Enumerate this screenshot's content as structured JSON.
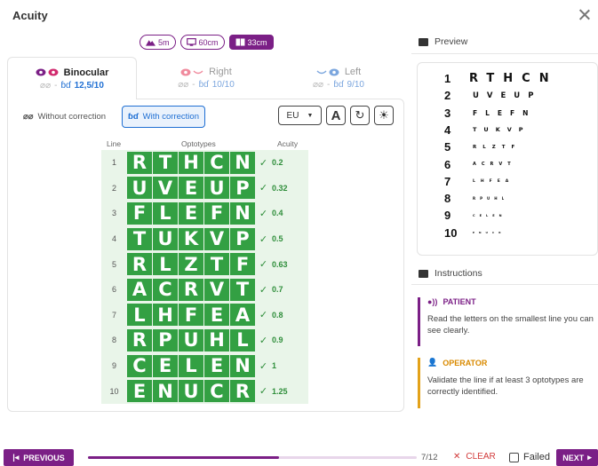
{
  "page": {
    "title": "Acuity"
  },
  "distances": [
    {
      "label": "5m",
      "icon": "mountain-icon",
      "active": false
    },
    {
      "label": "60cm",
      "icon": "monitor-icon",
      "active": false
    },
    {
      "label": "33cm",
      "icon": "book-icon",
      "active": true
    }
  ],
  "eyes": [
    {
      "name": "Binocular",
      "sep": "-",
      "acuity": "12,5/10",
      "active": true
    },
    {
      "name": "Right",
      "sep": "-",
      "acuity": "10/10",
      "active": false
    },
    {
      "name": "Left",
      "sep": "-",
      "acuity": "9/10",
      "active": false
    }
  ],
  "correction": {
    "without": "Without correction",
    "with": "With correction",
    "selected": "with"
  },
  "tools": {
    "chart_standard": "EU",
    "letter_button": "A"
  },
  "chart": {
    "headers": {
      "line": "Line",
      "optotypes": "Optotypes",
      "acuity": "Acuity"
    },
    "rows": [
      {
        "line": "1",
        "letters": [
          "R",
          "T",
          "H",
          "C",
          "N"
        ],
        "check": "✓",
        "acuity": "0.2"
      },
      {
        "line": "2",
        "letters": [
          "U",
          "V",
          "E",
          "U",
          "P"
        ],
        "check": "✓",
        "acuity": "0.32"
      },
      {
        "line": "3",
        "letters": [
          "F",
          "L",
          "E",
          "F",
          "N"
        ],
        "check": "✓",
        "acuity": "0.4"
      },
      {
        "line": "4",
        "letters": [
          "T",
          "U",
          "K",
          "V",
          "P"
        ],
        "check": "✓",
        "acuity": "0.5"
      },
      {
        "line": "5",
        "letters": [
          "R",
          "L",
          "Z",
          "T",
          "F"
        ],
        "check": "✓",
        "acuity": "0.63"
      },
      {
        "line": "6",
        "letters": [
          "A",
          "C",
          "R",
          "V",
          "T"
        ],
        "check": "✓",
        "acuity": "0.7"
      },
      {
        "line": "7",
        "letters": [
          "L",
          "H",
          "F",
          "E",
          "A"
        ],
        "check": "✓",
        "acuity": "0.8"
      },
      {
        "line": "8",
        "letters": [
          "R",
          "P",
          "U",
          "H",
          "L"
        ],
        "check": "✓",
        "acuity": "0.9"
      },
      {
        "line": "9",
        "letters": [
          "C",
          "E",
          "L",
          "E",
          "N"
        ],
        "check": "✓",
        "acuity": "1"
      },
      {
        "line": "10",
        "letters": [
          "E",
          "N",
          "U",
          "C",
          "R"
        ],
        "check": "✓",
        "acuity": "1.25"
      }
    ]
  },
  "preview": {
    "title": "Preview",
    "rows": [
      {
        "line": "1",
        "text": "RTHCN"
      },
      {
        "line": "2",
        "text": "UVEUP"
      },
      {
        "line": "3",
        "text": "FLEFN"
      },
      {
        "line": "4",
        "text": "TUKVP"
      },
      {
        "line": "5",
        "text": "RLZTF"
      },
      {
        "line": "6",
        "text": "ACRVT"
      },
      {
        "line": "7",
        "text": "LHFEA"
      },
      {
        "line": "8",
        "text": "RPUHL"
      },
      {
        "line": "9",
        "text": "CELEN"
      },
      {
        "line": "10",
        "text": "ENUCR"
      }
    ]
  },
  "instructions": {
    "title": "Instructions",
    "patient": {
      "label": "PATIENT",
      "text": "Read the letters on the smallest line you can see clearly."
    },
    "operator": {
      "label": "OPERATOR",
      "text": "Validate the line if at least 3 optotypes are correctly identified."
    }
  },
  "footer": {
    "previous": "PREVIOUS",
    "next": "NEXT",
    "step": "7/12",
    "progress": 0.58,
    "clear": "CLEAR",
    "failed": "Failed"
  },
  "colors": {
    "brand": "#7b1f86",
    "accent": "#1f6fd3",
    "success": "#33a043",
    "warning": "#e3a21a",
    "danger": "#d23a3a"
  }
}
